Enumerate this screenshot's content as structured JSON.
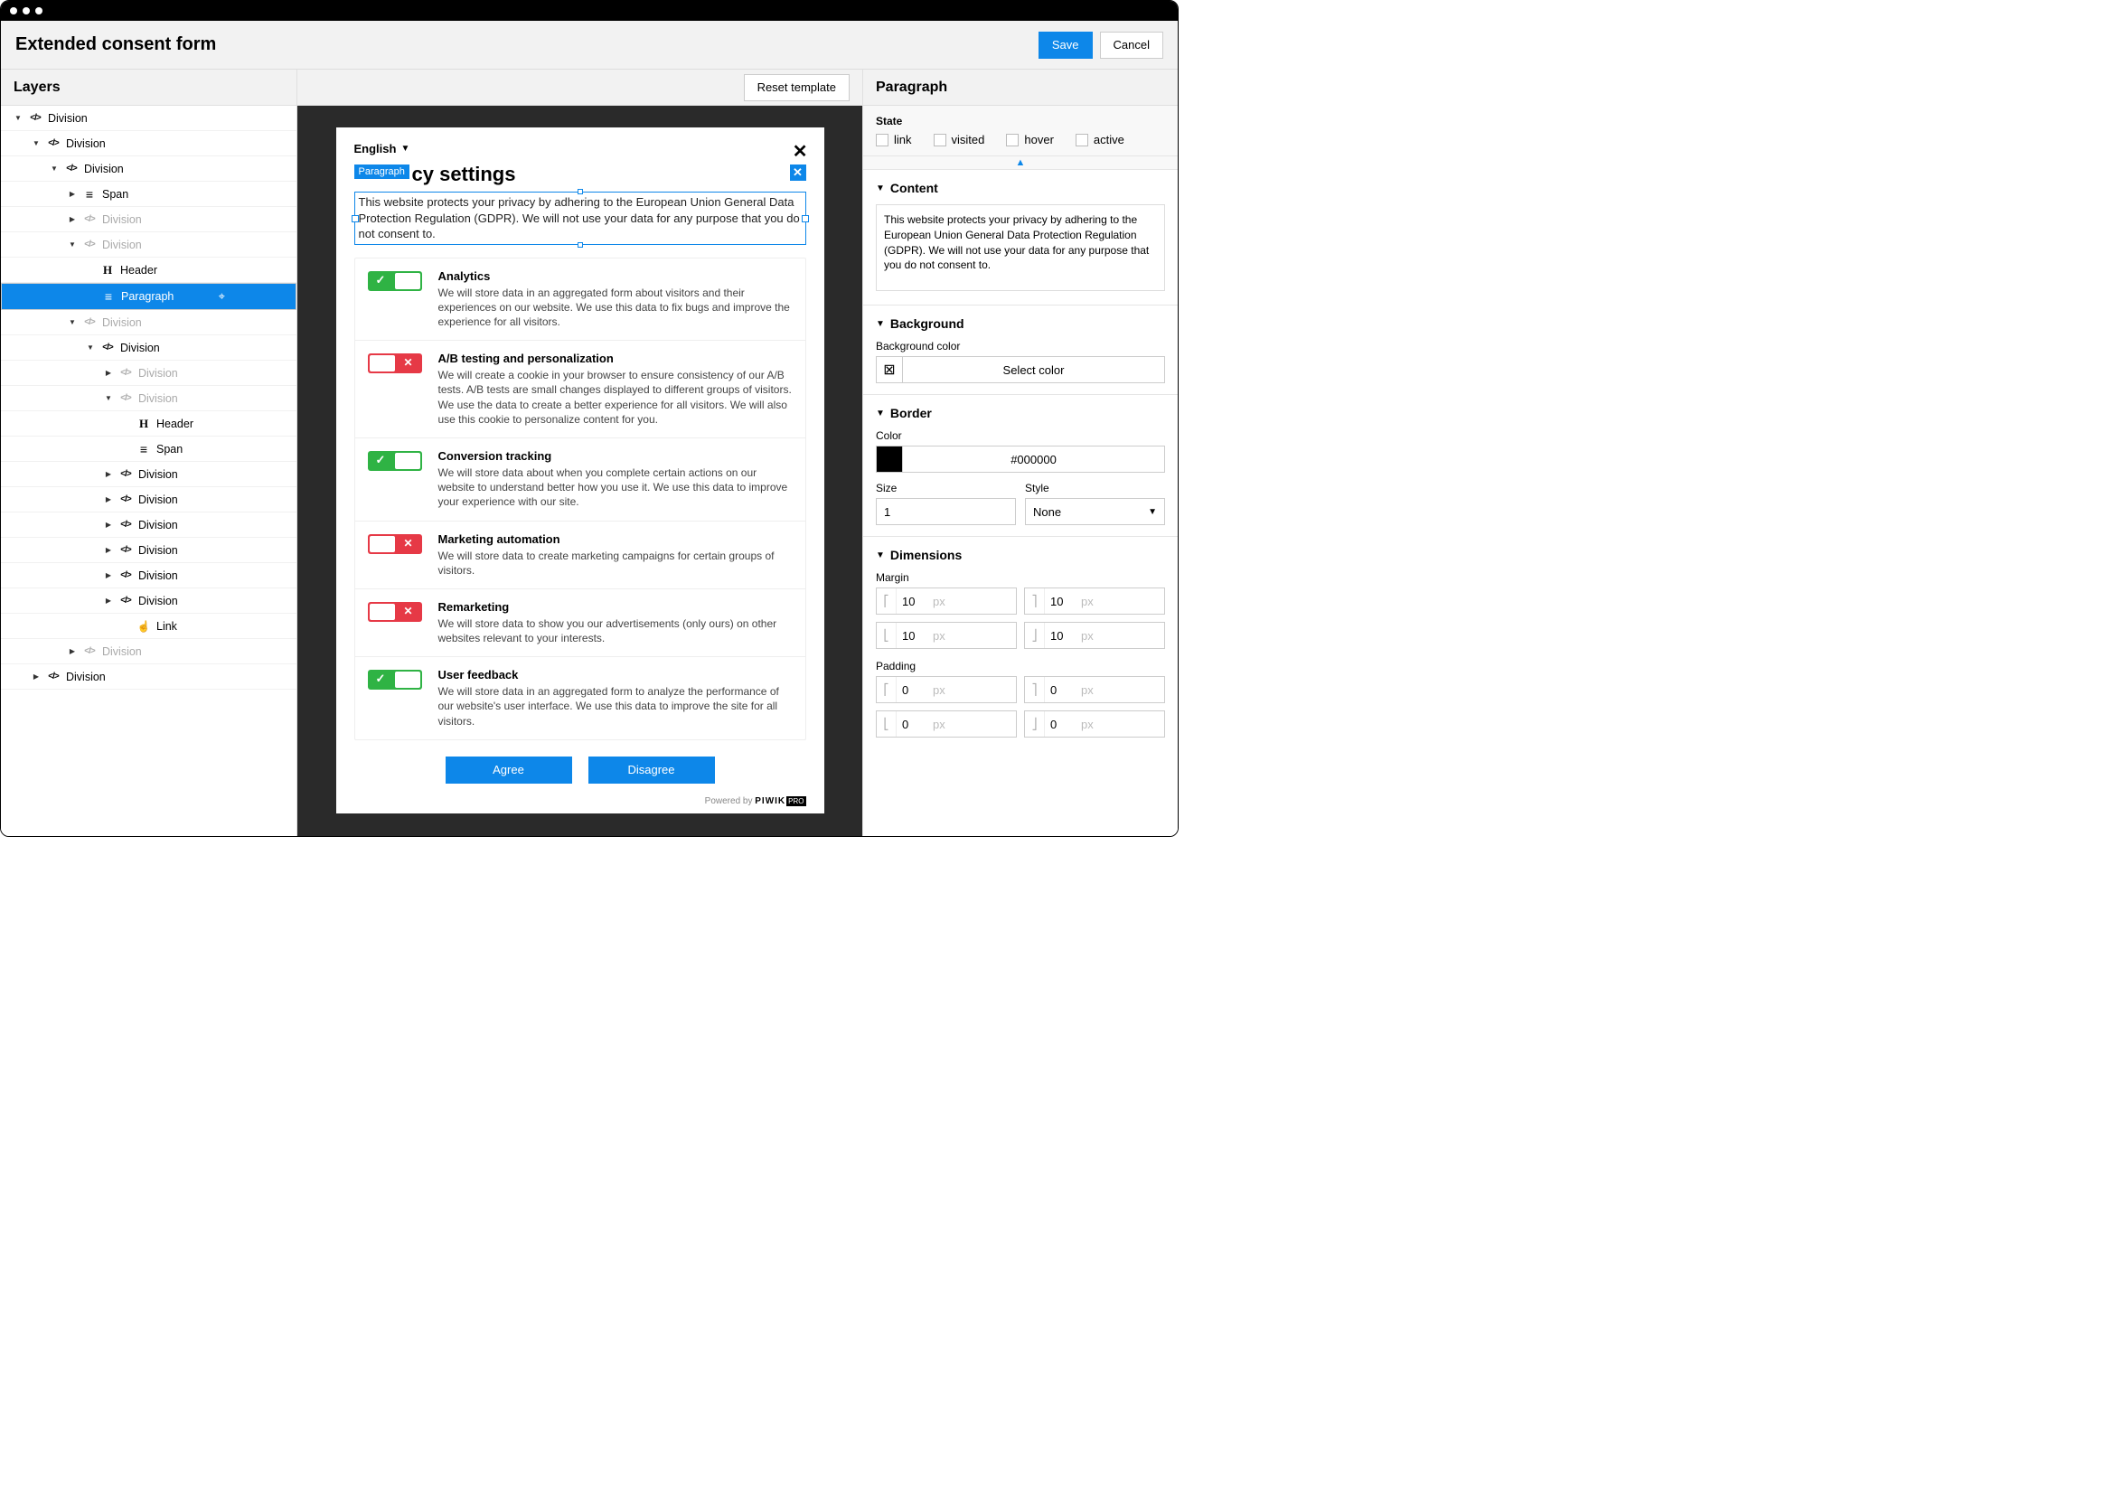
{
  "header": {
    "title": "Extended consent form",
    "save": "Save",
    "cancel": "Cancel"
  },
  "layers": {
    "title": "Layers",
    "items": [
      {
        "d": 0,
        "a": "down",
        "i": "code",
        "l": "Division"
      },
      {
        "d": 1,
        "a": "down",
        "i": "code",
        "l": "Division"
      },
      {
        "d": 2,
        "a": "down",
        "i": "code",
        "l": "Division"
      },
      {
        "d": 3,
        "a": "right",
        "i": "span",
        "l": "Span"
      },
      {
        "d": 3,
        "a": "right",
        "i": "code",
        "l": "Division",
        "dim": true
      },
      {
        "d": 3,
        "a": "down",
        "i": "code",
        "l": "Division",
        "dim": true
      },
      {
        "d": 4,
        "a": "none",
        "i": "header",
        "l": "Header"
      },
      {
        "d": 4,
        "a": "none",
        "i": "para",
        "l": "Paragraph",
        "sel": true,
        "cursor": true
      },
      {
        "d": 3,
        "a": "down",
        "i": "code",
        "l": "Division",
        "dim": true
      },
      {
        "d": 4,
        "a": "down",
        "i": "code",
        "l": "Division"
      },
      {
        "d": 5,
        "a": "right",
        "i": "code",
        "l": "Division",
        "dim": true
      },
      {
        "d": 5,
        "a": "down",
        "i": "code",
        "l": "Division",
        "dim": true
      },
      {
        "d": 6,
        "a": "none",
        "i": "header",
        "l": "Header"
      },
      {
        "d": 6,
        "a": "none",
        "i": "span",
        "l": "Span"
      },
      {
        "d": 5,
        "a": "right",
        "i": "code",
        "l": "Division"
      },
      {
        "d": 5,
        "a": "right",
        "i": "code",
        "l": "Division"
      },
      {
        "d": 5,
        "a": "right",
        "i": "code",
        "l": "Division"
      },
      {
        "d": 5,
        "a": "right",
        "i": "code",
        "l": "Division"
      },
      {
        "d": 5,
        "a": "right",
        "i": "code",
        "l": "Division"
      },
      {
        "d": 5,
        "a": "right",
        "i": "code",
        "l": "Division"
      },
      {
        "d": 6,
        "a": "none",
        "i": "link",
        "l": "Link"
      },
      {
        "d": 3,
        "a": "right",
        "i": "code",
        "l": "Division",
        "dim": true
      },
      {
        "d": 1,
        "a": "right",
        "i": "code",
        "l": "Division"
      }
    ]
  },
  "canvas": {
    "reset": "Reset template"
  },
  "modal": {
    "language": "English",
    "tag": "Paragraph",
    "heading": "cy settings",
    "paragraph": "This website protects your privacy by adhering to the European Union General Data Protection Regulation (GDPR). We will not use your data for any purpose that you do not consent to.",
    "items": [
      {
        "on": true,
        "title": "Analytics",
        "desc": "We will store data in an aggregated form about visitors and their experiences on our website. We use this data to fix bugs and improve the experience for all visitors."
      },
      {
        "on": false,
        "title": "A/B testing and personalization",
        "desc": "We will create a cookie in your browser to ensure consistency of our A/B tests. A/B tests are small changes displayed to different groups of visitors. We use the data to create a better experience for all visitors. We will also use this cookie to personalize content for you."
      },
      {
        "on": true,
        "title": "Conversion tracking",
        "desc": "We will store data about when you complete certain actions on our website to understand better how you use it. We use this data to improve your experience with our site."
      },
      {
        "on": false,
        "title": "Marketing automation",
        "desc": "We will store data to create marketing campaigns for certain groups of visitors."
      },
      {
        "on": false,
        "title": "Remarketing",
        "desc": "We will store data to show you our advertisements (only ours) on other websites relevant to your interests."
      },
      {
        "on": true,
        "title": "User feedback",
        "desc": "We will store data in an aggregated form to analyze the performance of our website's user interface. We use this data to improve the site for all visitors."
      }
    ],
    "agree": "Agree",
    "disagree": "Disagree",
    "powered": "Powered by",
    "brand": "PIWIK",
    "brand_suffix": "PRO"
  },
  "inspector": {
    "title": "Paragraph",
    "state_label": "State",
    "states": [
      "link",
      "visited",
      "hover",
      "active"
    ],
    "content_h": "Content",
    "content_v": "This website protects your privacy by adhering to the European Union General Data Protection Regulation (GDPR). We will not use your data for any purpose that you do not consent to.",
    "bg_h": "Background",
    "bg_color_l": "Background color",
    "bg_select": "Select color",
    "border_h": "Border",
    "border_color_l": "Color",
    "border_color_v": "#000000",
    "border_size_l": "Size",
    "border_size_v": "1",
    "border_style_l": "Style",
    "border_style_v": "None",
    "dim_h": "Dimensions",
    "margin_l": "Margin",
    "padding_l": "Padding",
    "margin": [
      {
        "v": "10",
        "u": "px"
      },
      {
        "v": "10",
        "u": "px"
      },
      {
        "v": "10",
        "u": "px"
      },
      {
        "v": "10",
        "u": "px"
      }
    ],
    "padding": [
      {
        "v": "0",
        "u": "px"
      },
      {
        "v": "0",
        "u": "px"
      },
      {
        "v": "0",
        "u": "px"
      },
      {
        "v": "0",
        "u": "px"
      }
    ]
  }
}
